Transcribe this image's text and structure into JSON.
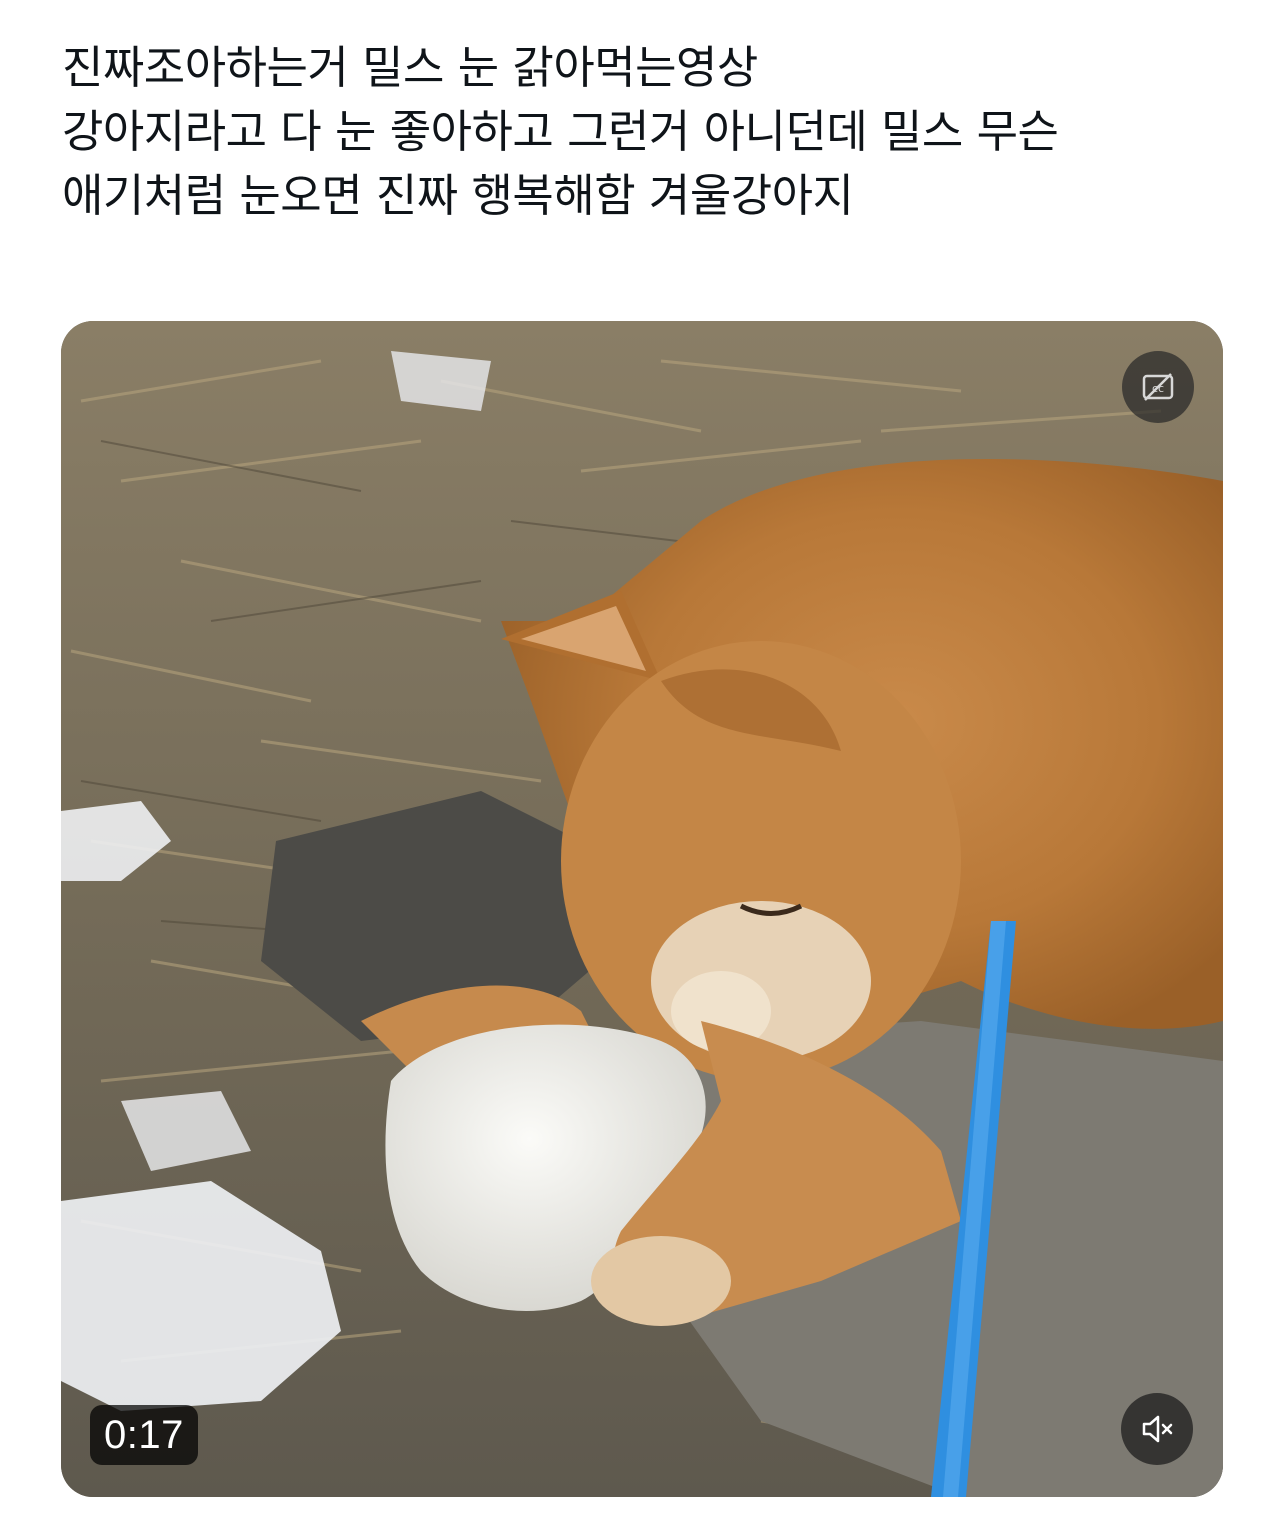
{
  "post": {
    "lines": [
      "진짜조아하는거 밀스 눈 갉아먹는영상",
      "강아지라고 다 눈 좋아하고 그런거 아니던데 밀스 무슨",
      "애기처럼 눈오면 진짜 행복해함 겨울강아지"
    ]
  },
  "video": {
    "timestamp": "0:17",
    "captions_icon": "captions-off-icon",
    "volume_icon": "volume-muted-icon",
    "overlay_color": "#000000",
    "leash_color": "#2f8fe0"
  }
}
